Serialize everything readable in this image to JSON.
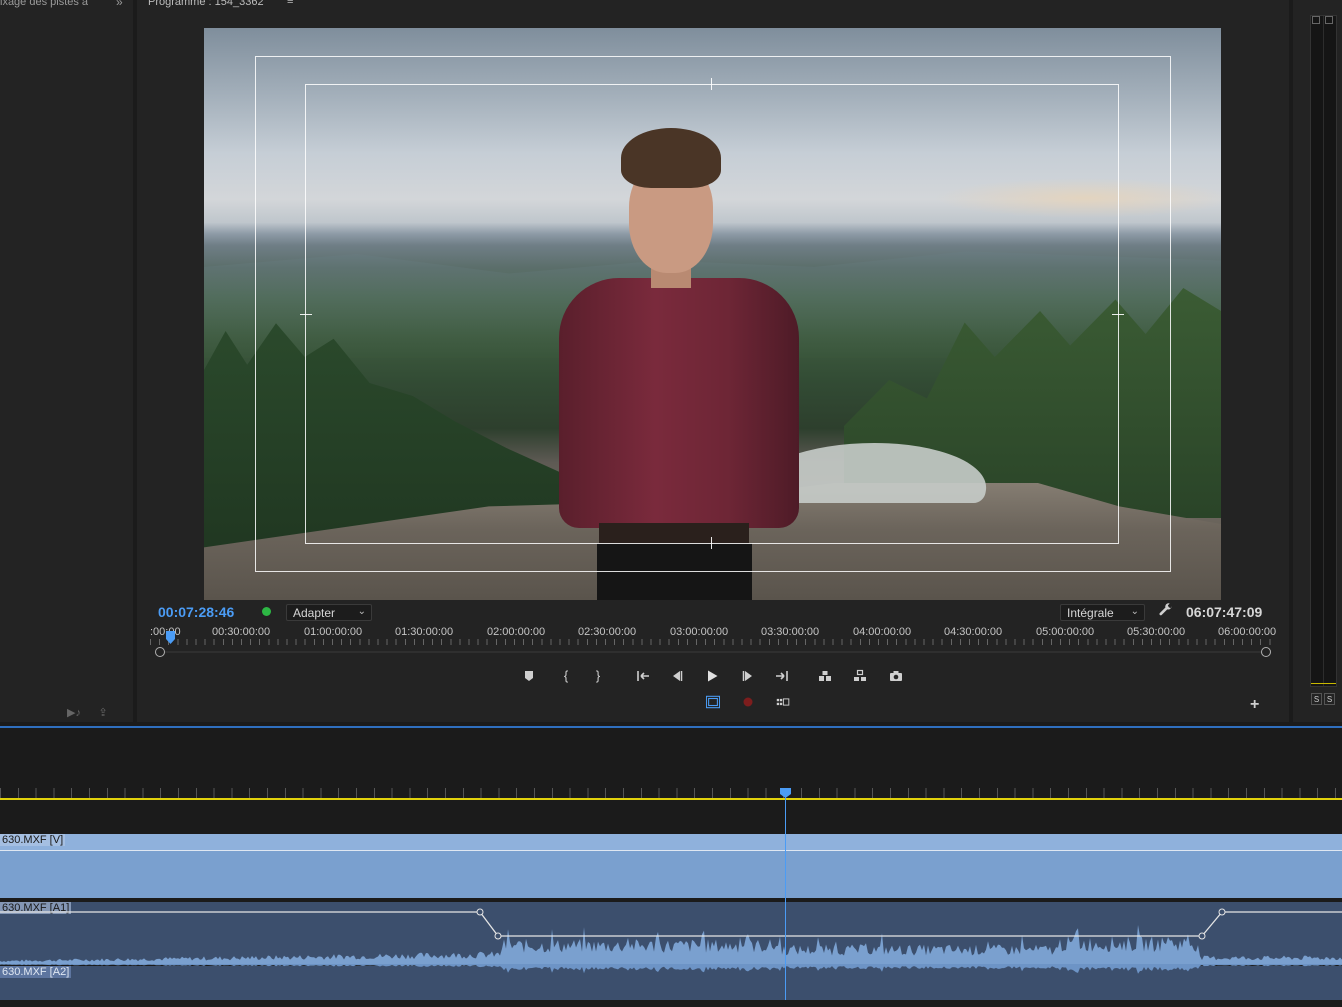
{
  "left_panel": {
    "title": "ixage des pistes a",
    "more_icon": "double-chevron-right-icon",
    "footer_icons": [
      "export-audio-icon",
      "export-icon"
    ]
  },
  "monitor": {
    "title": "Programme : 154_3362",
    "menu_icon": "hamburger-icon",
    "current_timecode": "00:07:28:46",
    "duration_timecode": "06:07:47:09",
    "zoom_select": "Adapter",
    "quality_select": "Intégrale",
    "ruler_labels": [
      ":00:00",
      "00:30:00:00",
      "01:00:00:00",
      "01:30:00:00",
      "02:00:00:00",
      "02:30:00:00",
      "03:00:00:00",
      "03:30:00:00",
      "04:00:00:00",
      "04:30:00:00",
      "05:00:00:00",
      "05:30:00:00",
      "06:00:00:00"
    ],
    "status_color": "#2db744",
    "accent_color": "#4b9cf5",
    "transport_icons": [
      "marker-icon",
      "mark-in-icon",
      "mark-out-icon",
      "go-to-in-icon",
      "step-back-icon",
      "play-icon",
      "step-forward-icon",
      "go-to-out-icon",
      "lift-icon",
      "extract-icon",
      "export-frame-icon"
    ],
    "secondary_icons": [
      "safe-margins-icon",
      "record-icon",
      "compare-view-icon"
    ],
    "add_button": "+"
  },
  "meters": {
    "solo_labels": [
      "S",
      "S"
    ]
  },
  "timeline": {
    "clips": {
      "v1": "630.MXF [V]",
      "a1": "630.MXF [A1]",
      "a2": "630.MXF [A2]"
    },
    "work_area_color": "#e1d20c",
    "video_clip_color": "#7aa0cf",
    "audio_clip_color": "#3c4f6d"
  }
}
